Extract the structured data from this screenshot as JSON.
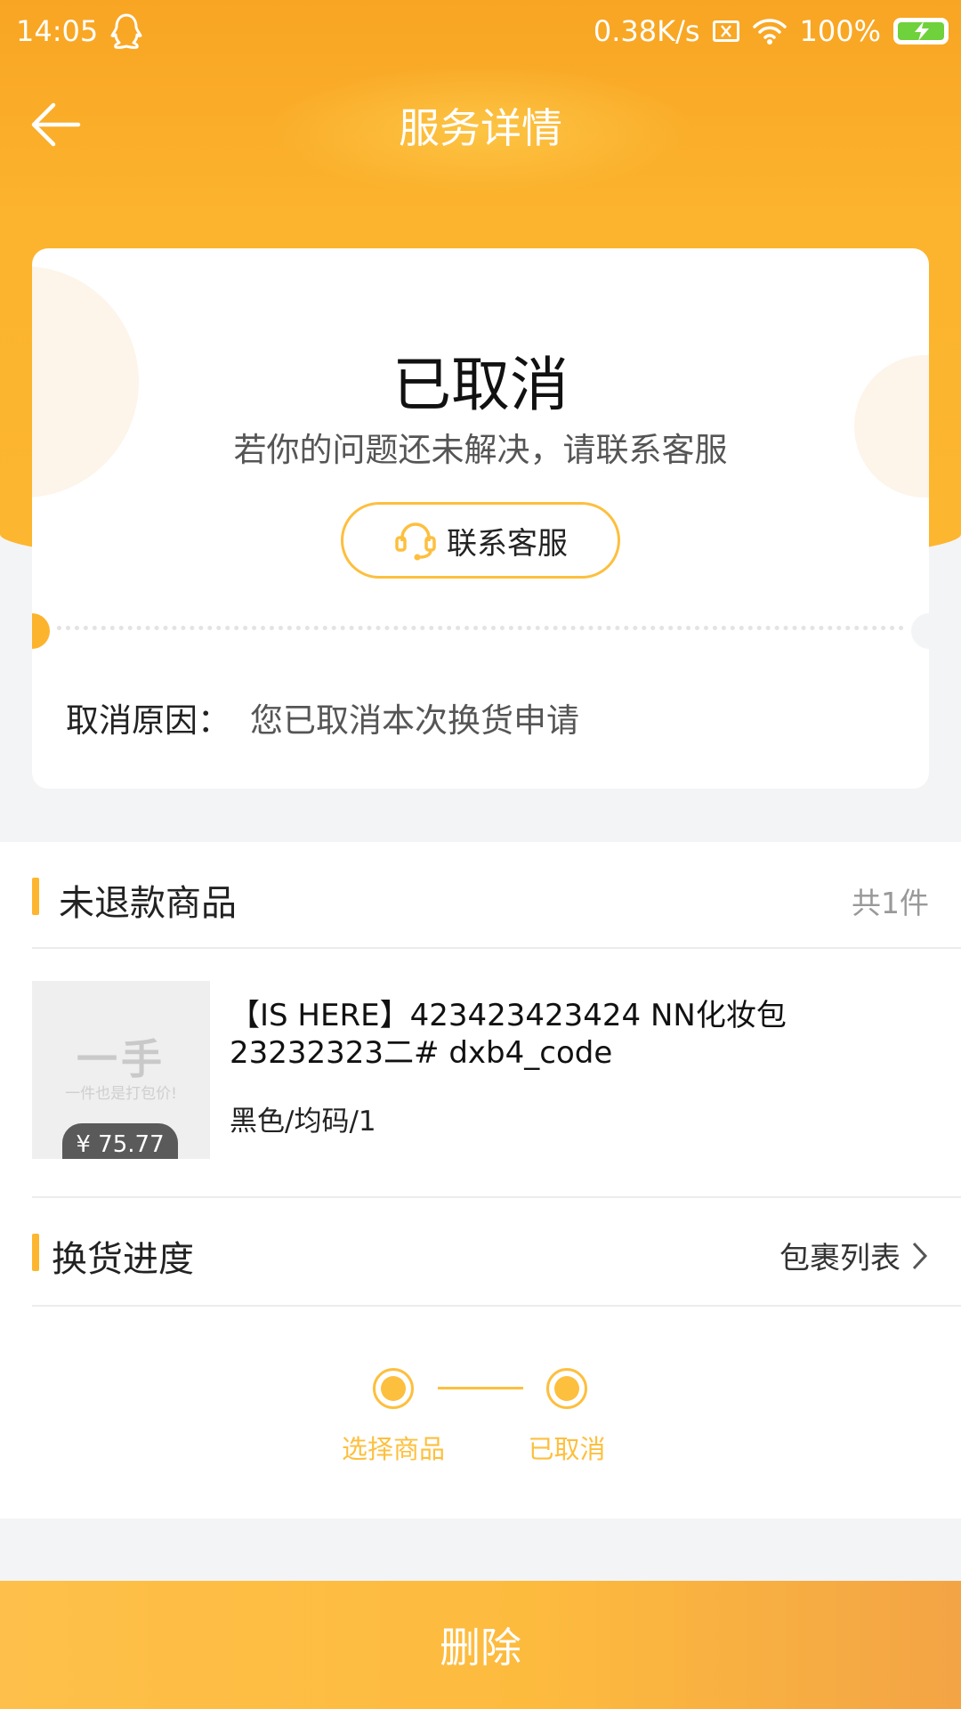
{
  "status_bar": {
    "time": "14:05",
    "net_speed": "0.38K/s",
    "battery": "100%"
  },
  "header": {
    "title": "服务详情"
  },
  "status_card": {
    "status": "已取消",
    "hint": "若你的问题还未解决，请联系客服",
    "contact_label": "联系客服",
    "reason_label": "取消原因：",
    "reason_value": "您已取消本次换货申请"
  },
  "products": {
    "section_title": "未退款商品",
    "count": "共1件",
    "items": [
      {
        "title": "【IS HERE】423423423424 NN化妆包 23232323二# dxb4_code",
        "spec": "黑色/均码/1",
        "price": "¥ 75.77",
        "thumb_big": "一手",
        "thumb_small": "一件也是打包价!"
      }
    ]
  },
  "progress": {
    "section_title": "换货进度",
    "link_label": "包裹列表",
    "steps": [
      {
        "label": "选择商品"
      },
      {
        "label": "已取消"
      }
    ]
  },
  "footer": {
    "delete_label": "删除"
  },
  "colors": {
    "accent": "#fdb62f",
    "header": "#f8a523",
    "text": "#222222",
    "muted": "#555555"
  },
  "icons": {
    "back": "arrow-left-icon",
    "contact": "headset-icon",
    "link": "chevron-right-icon"
  }
}
